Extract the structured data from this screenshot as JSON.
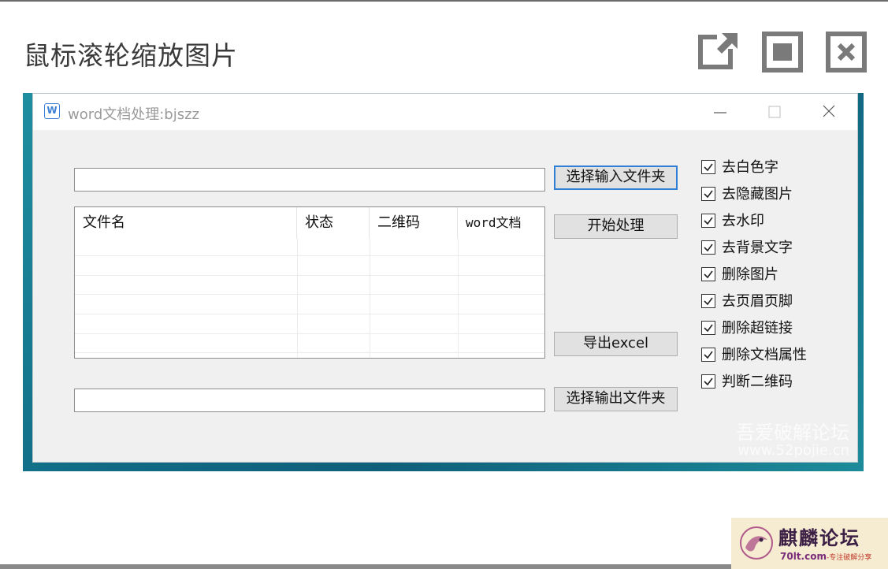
{
  "viewer": {
    "title": "鼠标滚轮缩放图片",
    "buttons": [
      {
        "name": "open-external",
        "icon": "open-external-icon"
      },
      {
        "name": "fullscreen",
        "icon": "fullscreen-icon"
      },
      {
        "name": "close",
        "icon": "close-icon"
      }
    ]
  },
  "app": {
    "window_title": "word文档处理:bjszz",
    "icon_letter": "W",
    "input_folder_value": "",
    "output_folder_value": "",
    "buttons": {
      "select_input": "选择输入文件夹",
      "start": "开始处理",
      "export": "导出excel",
      "select_output": "选择输出文件夹"
    },
    "table": {
      "columns": [
        "文件名",
        "状态",
        "二维码",
        "word文档"
      ],
      "rows": []
    },
    "options": [
      {
        "label": "去白色字",
        "checked": true
      },
      {
        "label": "去隐藏图片",
        "checked": true
      },
      {
        "label": "去水印",
        "checked": true
      },
      {
        "label": "去背景文字",
        "checked": true
      },
      {
        "label": "删除图片",
        "checked": true
      },
      {
        "label": "去页眉页脚",
        "checked": true
      },
      {
        "label": "删除超链接",
        "checked": true
      },
      {
        "label": "删除文档属性",
        "checked": true
      },
      {
        "label": "判断二维码",
        "checked": true
      }
    ]
  },
  "watermark": {
    "line1": "吾爱破解论坛",
    "line2": "www.52pojie.cn"
  },
  "corner_logo": {
    "name": "麒麟论坛",
    "url": "70lt.com",
    "tagline": "-专注破解分享"
  },
  "colors": {
    "accent": "#2f7fd6",
    "window_bg": "#f0f0f0",
    "desktop": "#116c86"
  }
}
